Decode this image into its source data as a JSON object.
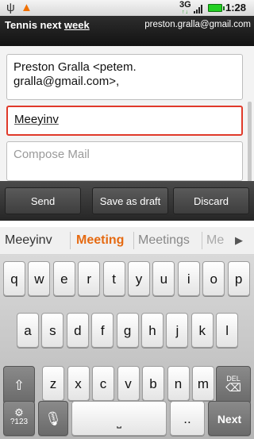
{
  "status_bar": {
    "usb_icon": "usb-icon",
    "warning_icon": "warning-icon",
    "network": "3G",
    "time": "1:28"
  },
  "title_bar": {
    "subject_prefix": "Tennis next ",
    "subject_underlined": "week",
    "account": "preston.gralla@gmail.com"
  },
  "compose": {
    "to_value": "Preston Gralla <petem. gralla@gmail.com>,",
    "cc_value": "Meeyinv",
    "body_placeholder": "Compose Mail"
  },
  "actions": {
    "send": "Send",
    "save_draft": "Save as draft",
    "discard": "Discard"
  },
  "suggestions": {
    "items": [
      "Meeyinv",
      "Meeting",
      "Meetings",
      "Me"
    ],
    "more_icon": "play-arrow-icon"
  },
  "keyboard": {
    "row1": [
      "q",
      "w",
      "e",
      "r",
      "t",
      "y",
      "u",
      "i",
      "o",
      "p"
    ],
    "row2": [
      "a",
      "s",
      "d",
      "f",
      "g",
      "h",
      "j",
      "k",
      "l"
    ],
    "row3": [
      "z",
      "x",
      "c",
      "v",
      "b",
      "n",
      "m"
    ],
    "del_label": "DEL",
    "symbols_label": "?123",
    "dot_label": "..",
    "next_label": "Next"
  },
  "colors": {
    "accent_orange": "#e56a12",
    "error_red": "#e03a2a"
  }
}
